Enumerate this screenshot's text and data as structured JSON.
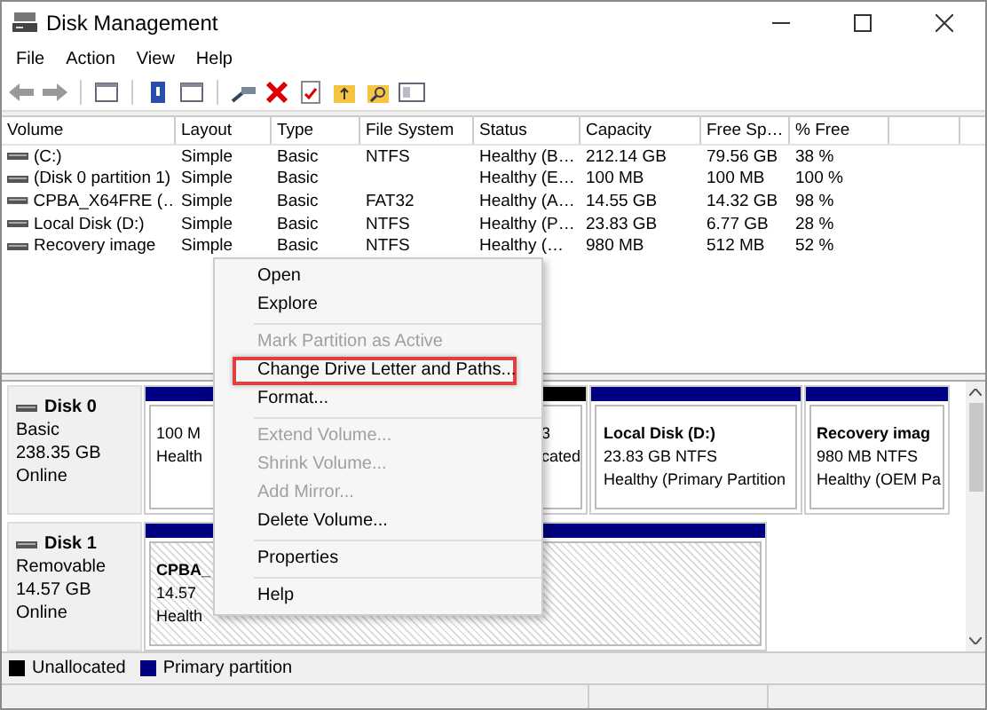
{
  "window": {
    "title": "Disk Management"
  },
  "menu_bar": [
    "File",
    "Action",
    "View",
    "Help"
  ],
  "volumes": {
    "columns": [
      "Volume",
      "Layout",
      "Type",
      "File System",
      "Status",
      "Capacity",
      "Free Sp…",
      "% Free"
    ],
    "rows": [
      [
        "(C:)",
        "Simple",
        "Basic",
        "NTFS",
        "Healthy (B…",
        "212.14 GB",
        "79.56 GB",
        "38 %"
      ],
      [
        "(Disk 0 partition 1)",
        "Simple",
        "Basic",
        null,
        "Healthy (E…",
        "100 MB",
        "100 MB",
        "100 %"
      ],
      [
        "CPBA_X64FRE (…",
        "Simple",
        "Basic",
        "FAT32",
        "Healthy (A…",
        "14.55 GB",
        "14.32 GB",
        "98 %"
      ],
      [
        "Local Disk (D:)",
        "Simple",
        "Basic",
        "NTFS",
        "Healthy (P…",
        "23.83 GB",
        "6.77 GB",
        "28 %"
      ],
      [
        "Recovery image",
        "Simple",
        "Basic",
        "NTFS",
        "Healthy (…",
        "980 MB",
        "512 MB",
        "52 %"
      ]
    ]
  },
  "disks": [
    {
      "name": "Disk 0",
      "lines": [
        "Basic",
        "238.35 GB",
        "Online"
      ],
      "partitions": [
        {
          "color": "#000080",
          "selected": false,
          "size": "100 M",
          "status": "Health"
        },
        {
          "color": "#000000",
          "selected": false,
          "size": "3",
          "status": "cated"
        },
        {
          "color": "#000080",
          "selected": false,
          "name": "Local Disk  (D:)",
          "size": "23.83 GB NTFS",
          "status": "Healthy (Primary Partition"
        },
        {
          "color": "#000080",
          "selected": false,
          "name": "Recovery imag",
          "size": "980 MB NTFS",
          "status": "Healthy (OEM Pa"
        }
      ]
    },
    {
      "name": "Disk 1",
      "lines": [
        "Removable",
        "14.57 GB",
        "Online"
      ],
      "partitions": [
        {
          "color": "#000080",
          "selected": true,
          "name": "CPBA_",
          "size": "14.57",
          "status": "Health"
        }
      ]
    }
  ],
  "legend": [
    {
      "label": "Unallocated",
      "color": "#000000"
    },
    {
      "label": "Primary partition",
      "color": "#000080"
    }
  ],
  "context_menu": {
    "items": [
      {
        "kind": "item",
        "label": "Open",
        "disabled": false,
        "highlighted": false
      },
      {
        "kind": "item",
        "label": "Explore",
        "disabled": false,
        "highlighted": false
      },
      {
        "kind": "separator"
      },
      {
        "kind": "item",
        "label": "Mark Partition as Active",
        "disabled": true,
        "highlighted": false
      },
      {
        "kind": "item",
        "label": "Change Drive Letter and Paths...",
        "disabled": false,
        "highlighted": true
      },
      {
        "kind": "item",
        "label": "Format...",
        "disabled": false,
        "highlighted": false
      },
      {
        "kind": "separator"
      },
      {
        "kind": "item",
        "label": "Extend Volume...",
        "disabled": true,
        "highlighted": false
      },
      {
        "kind": "item",
        "label": "Shrink Volume...",
        "disabled": true,
        "highlighted": false
      },
      {
        "kind": "item",
        "label": "Add Mirror...",
        "disabled": true,
        "highlighted": false
      },
      {
        "kind": "item",
        "label": "Delete Volume...",
        "disabled": false,
        "highlighted": false
      },
      {
        "kind": "separator"
      },
      {
        "kind": "item",
        "label": "Properties",
        "disabled": false,
        "highlighted": false
      },
      {
        "kind": "separator"
      },
      {
        "kind": "item",
        "label": "Help",
        "disabled": false,
        "highlighted": false
      }
    ]
  }
}
